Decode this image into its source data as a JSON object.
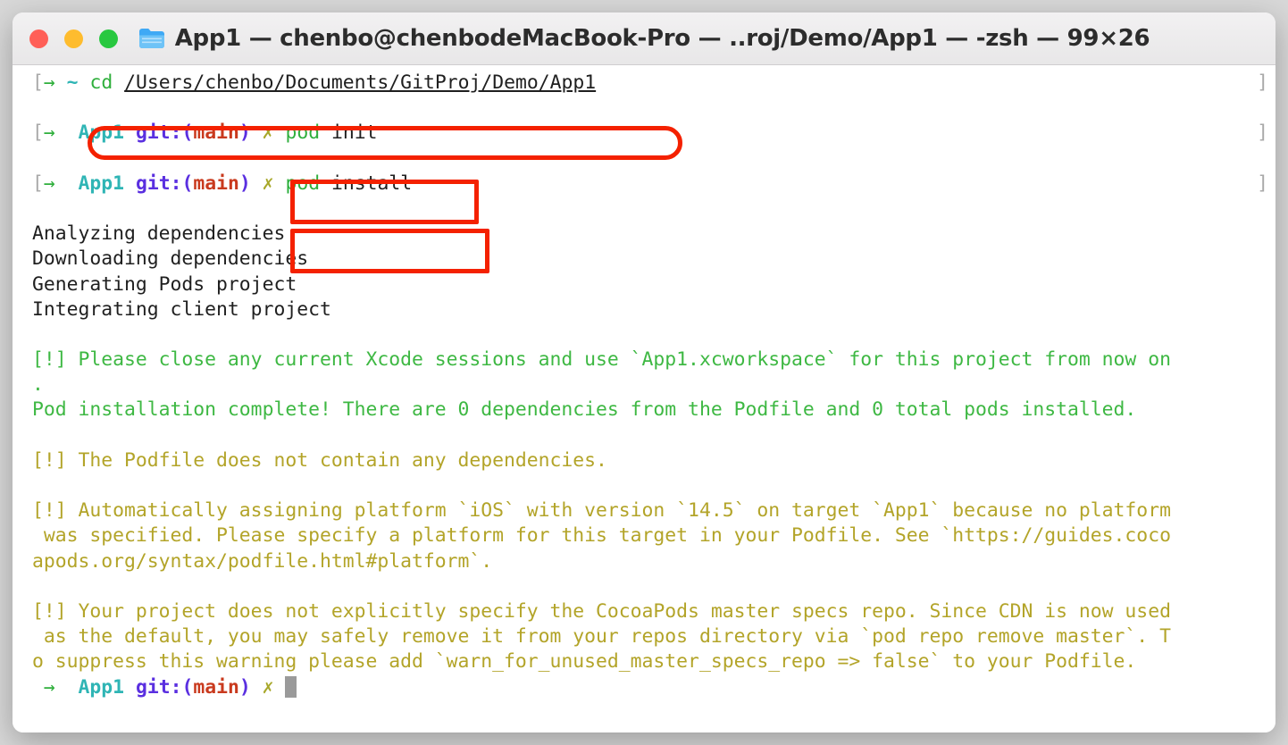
{
  "window": {
    "title": "App1 — chenbo@chenbodeMacBook-Pro — ..roj/Demo/App1 — -zsh — 99×26",
    "folder_icon": "folder-icon",
    "traffic_lights": [
      {
        "name": "close-button",
        "color": "#ff5f57"
      },
      {
        "name": "minimize-button",
        "color": "#febc2e"
      },
      {
        "name": "maximize-button",
        "color": "#28c840"
      }
    ]
  },
  "colors": {
    "annotation": "#f42100",
    "prompt_arrow": "#2faf3c",
    "prompt_dir": "#2fb5b5",
    "git_label": "#5a2fe0",
    "git_branch": "#c93a1e",
    "dirty_marker": "#a8a82b",
    "command": "#2faf3c",
    "success_text": "#3eb843",
    "warning_text": "#b3a429",
    "marker_bracket": "#a9a9a9"
  },
  "terminal": {
    "prompt": {
      "open_bracket": "[",
      "arrow": "→",
      "arrow_last": "→",
      "close_marker": "]",
      "dir_home": "~",
      "dir_app": "App1",
      "git_open": "git:(",
      "git_branch": "main",
      "git_close": ")",
      "dirty": "✗"
    },
    "commands": {
      "cd_cmd": "cd",
      "cd_path": "/Users/chenbo/Documents/GitProj/Demo/App1",
      "pod_cmd": "pod",
      "pod_init_arg": "init",
      "pod_install_arg": "install"
    },
    "output": {
      "line_analyzing": "Analyzing dependencies",
      "line_downloading": "Downloading dependencies",
      "line_generating": "Generating Pods project",
      "line_integrating": "Integrating client project",
      "green_1a": "[!] Please close any current Xcode sessions and use `App1.xcworkspace` for this project from now on",
      "green_1b": ".",
      "green_2": "Pod installation complete! There are 0 dependencies from the Podfile and 0 total pods installed.",
      "warn_1": "[!] The Podfile does not contain any dependencies.",
      "warn_2a": "[!] Automatically assigning platform `iOS` with version `14.5` on target `App1` because no platform",
      "warn_2b": " was specified. Please specify a platform for this target in your Podfile. See `https://guides.coco",
      "warn_2c": "apods.org/syntax/podfile.html#platform`.",
      "warn_3a": "[!] Your project does not explicitly specify the CocoaPods master specs repo. Since CDN is now used",
      "warn_3b": " as the default, you may safely remove it from your repos directory via `pod repo remove master`. T",
      "warn_3c": "o suppress this warning please add `warn_for_unused_master_specs_repo => false` to your Podfile."
    },
    "cursor": "cursor-block"
  },
  "annotations": [
    {
      "name": "annotation-cd-command",
      "shape": "pill"
    },
    {
      "name": "annotation-pod-init-command",
      "shape": "rect"
    },
    {
      "name": "annotation-pod-install-command",
      "shape": "rect"
    }
  ]
}
